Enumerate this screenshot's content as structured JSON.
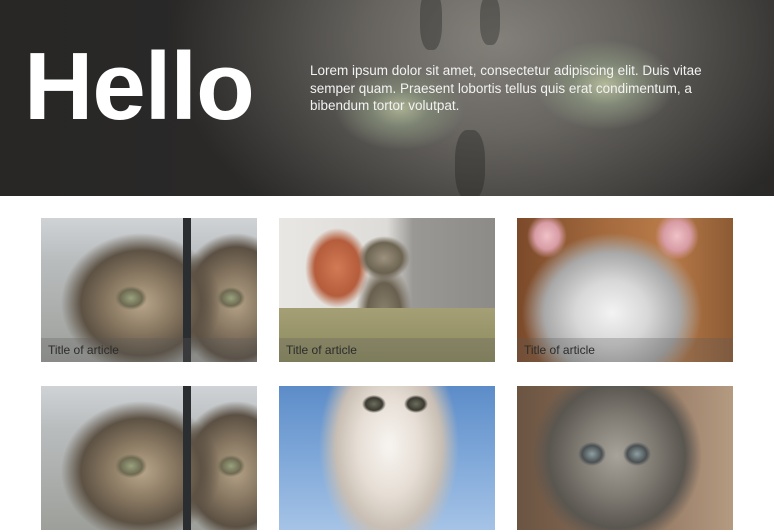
{
  "hero": {
    "title": "Hello",
    "text": "Lorem ipsum dolor sit amet, consectetur adipiscing elit. Duis vitae semper quam. Praesent lobortis tellus quis erat condimentum, a bibendum tortor volutpat."
  },
  "articles": [
    {
      "title": "Title of article"
    },
    {
      "title": "Title of article"
    },
    {
      "title": "Title of article"
    },
    {
      "title": ""
    },
    {
      "title": ""
    },
    {
      "title": ""
    }
  ]
}
